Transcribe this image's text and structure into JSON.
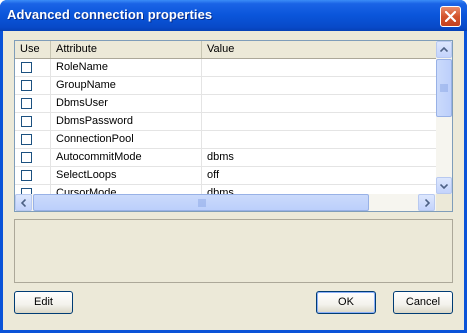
{
  "dialog": {
    "title": "Advanced connection properties"
  },
  "grid": {
    "columns": [
      {
        "key": "use",
        "label": "Use"
      },
      {
        "key": "attribute",
        "label": "Attribute"
      },
      {
        "key": "value",
        "label": "Value"
      }
    ],
    "rows": [
      {
        "use": false,
        "attribute": "RoleName",
        "value": ""
      },
      {
        "use": false,
        "attribute": "GroupName",
        "value": ""
      },
      {
        "use": false,
        "attribute": "DbmsUser",
        "value": ""
      },
      {
        "use": false,
        "attribute": "DbmsPassword",
        "value": ""
      },
      {
        "use": false,
        "attribute": "ConnectionPool",
        "value": ""
      },
      {
        "use": false,
        "attribute": "AutocommitMode",
        "value": "dbms"
      },
      {
        "use": false,
        "attribute": "SelectLoops",
        "value": "off"
      },
      {
        "use": false,
        "attribute": "CursorMode",
        "value": "dbms"
      }
    ]
  },
  "buttons": {
    "edit": "Edit",
    "ok": "OK",
    "cancel": "Cancel"
  },
  "colors": {
    "titlebar": "#0a55da",
    "client": "#ece9d8",
    "close": "#d4542c"
  }
}
